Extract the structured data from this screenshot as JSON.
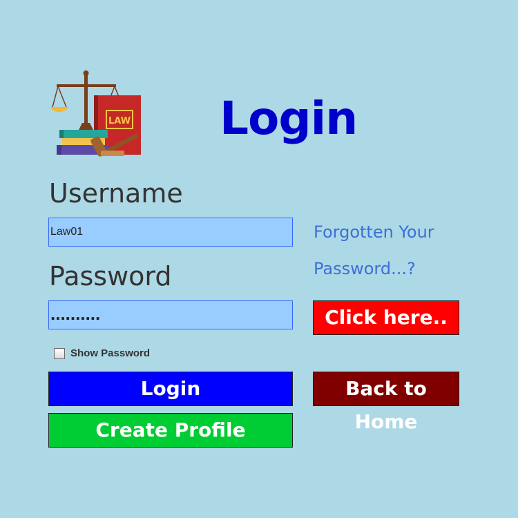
{
  "header": {
    "title": "Login",
    "logo_text": "LAW"
  },
  "form": {
    "username_label": "Username",
    "username_value": "Law01",
    "password_label": "Password",
    "password_value": "..........",
    "show_password_label": "Show Password",
    "show_password_checked": false
  },
  "forgot": {
    "line1": "Forgotten Your",
    "line2": "Password...?",
    "click_here_label": "Click here.."
  },
  "buttons": {
    "login_label": "Login",
    "create_profile_label": "Create Profile",
    "back_home_label": "Back to Home"
  },
  "colors": {
    "background": "#add8e6",
    "title": "#0000cd",
    "login_button": "#0000ff",
    "create_profile_button": "#00cc33",
    "click_here_button": "#ff0000",
    "back_home_button": "#800000",
    "input_background": "#99ccff"
  }
}
